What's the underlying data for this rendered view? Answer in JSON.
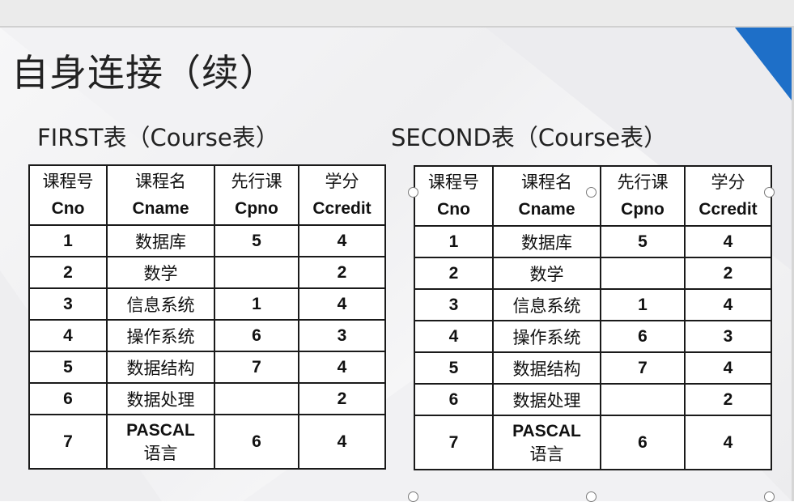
{
  "slide": {
    "title": "自身连接（续）",
    "accent_color": "#1e6fc8"
  },
  "first_table": {
    "caption": "FIRST表（Course表）",
    "headers": [
      {
        "cn": "课程号",
        "en": "Cno"
      },
      {
        "cn": "课程名",
        "en": "Cname"
      },
      {
        "cn": "先行课",
        "en": "Cpno"
      },
      {
        "cn": "学分",
        "en": "Ccredit"
      }
    ],
    "rows": [
      {
        "cno": "1",
        "cname": "数据库",
        "cpno": "5",
        "ccredit": "4"
      },
      {
        "cno": "2",
        "cname": "数学",
        "cpno": "",
        "ccredit": "2"
      },
      {
        "cno": "3",
        "cname": "信息系统",
        "cpno": "1",
        "ccredit": "4"
      },
      {
        "cno": "4",
        "cname": "操作系统",
        "cpno": "6",
        "ccredit": "3"
      },
      {
        "cno": "5",
        "cname": "数据结构",
        "cpno": "7",
        "ccredit": "4"
      },
      {
        "cno": "6",
        "cname": "数据处理",
        "cpno": "",
        "ccredit": "2"
      },
      {
        "cno": "7",
        "cname_line1": "PASCAL",
        "cname_line2": "语言",
        "cpno": "6",
        "ccredit": "4"
      }
    ]
  },
  "second_table": {
    "caption": "SECOND表（Course表）",
    "headers": [
      {
        "cn": "课程号",
        "en": "Cno"
      },
      {
        "cn": "课程名",
        "en": "Cname"
      },
      {
        "cn": "先行课",
        "en": "Cpno"
      },
      {
        "cn": "学分",
        "en": "Ccredit"
      }
    ],
    "rows": [
      {
        "cno": "1",
        "cname": "数据库",
        "cpno": "5",
        "ccredit": "4"
      },
      {
        "cno": "2",
        "cname": "数学",
        "cpno": "",
        "ccredit": "2"
      },
      {
        "cno": "3",
        "cname": "信息系统",
        "cpno": "1",
        "ccredit": "4"
      },
      {
        "cno": "4",
        "cname": "操作系统",
        "cpno": "6",
        "ccredit": "3"
      },
      {
        "cno": "5",
        "cname": "数据结构",
        "cpno": "7",
        "ccredit": "4"
      },
      {
        "cno": "6",
        "cname": "数据处理",
        "cpno": "",
        "ccredit": "2"
      },
      {
        "cno": "7",
        "cname_line1": "PASCAL",
        "cname_line2": "语言",
        "cpno": "6",
        "ccredit": "4"
      }
    ]
  }
}
